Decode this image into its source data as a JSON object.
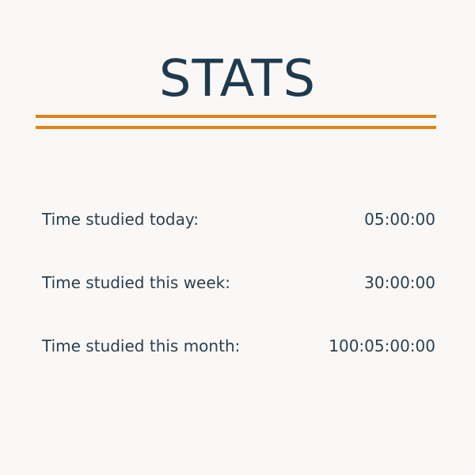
{
  "header": {
    "title": "STATS"
  },
  "colors": {
    "accent": "#e08318",
    "text": "#1f3a4d",
    "background": "#faf8f7"
  },
  "stats": [
    {
      "label": "Time studied today:",
      "value": "05:00:00"
    },
    {
      "label": "Time studied this week:",
      "value": "30:00:00"
    },
    {
      "label": "Time studied this month:",
      "value": "100:05:00:00"
    }
  ]
}
